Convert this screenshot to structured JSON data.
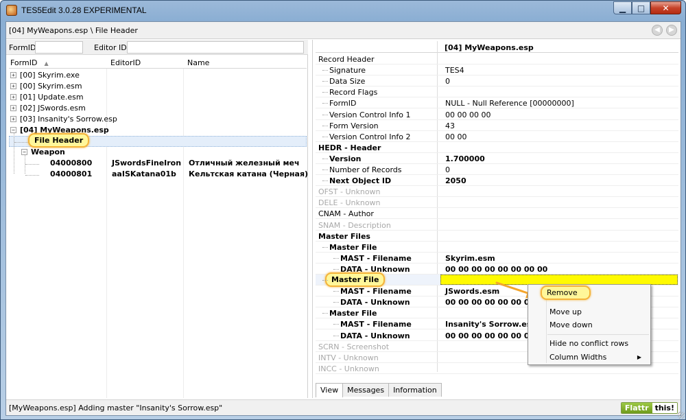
{
  "window": {
    "title": "TES5Edit 3.0.28 EXPERIMENTAL",
    "min": "▁",
    "max": "□",
    "close": "✕"
  },
  "pathbar": {
    "path": "[04] MyWeapons.esp \\ File Header",
    "back": "◀",
    "forward": "▶"
  },
  "filter": {
    "formid_label": "FormID",
    "editorid_label": "Editor ID"
  },
  "tree": {
    "columns": {
      "formid": "FormID",
      "editorid": "EditorID",
      "name": "Name",
      "sort_glyph": "▲"
    },
    "plugins": [
      {
        "label": "[00] Skyrim.exe",
        "expander": "+"
      },
      {
        "label": "[00] Skyrim.esm",
        "expander": "+"
      },
      {
        "label": "[01] Update.esm",
        "expander": "+"
      },
      {
        "label": "[02] JSwords.esm",
        "expander": "+"
      },
      {
        "label": "[03] Insanity's Sorrow.esp",
        "expander": "+"
      },
      {
        "label": "[04] MyWeapons.esp",
        "expander": "−"
      }
    ],
    "file_header": "File Header",
    "group": {
      "label": "Weapon",
      "expander": "−"
    },
    "records": [
      {
        "formid": "04000800",
        "editorid": "JSwordsFineIron",
        "name": "Отличный железный меч"
      },
      {
        "formid": "04000801",
        "editorid": "aaISKatana01b",
        "name": "Кельтская катана (Черная)"
      }
    ]
  },
  "view": {
    "header": "[04] MyWeapons.esp",
    "rows": [
      {
        "key": "Record Header",
        "value": "",
        "indent": 0,
        "style": "normal"
      },
      {
        "key": "Signature",
        "value": "TES4",
        "indent": 1,
        "style": "normal"
      },
      {
        "key": "Data Size",
        "value": "0",
        "indent": 1,
        "style": "normal"
      },
      {
        "key": "Record Flags",
        "value": "",
        "indent": 1,
        "style": "normal"
      },
      {
        "key": "FormID",
        "value": "NULL - Null Reference [00000000]",
        "indent": 1,
        "style": "normal"
      },
      {
        "key": "Version Control Info 1",
        "value": "00 00 00 00",
        "indent": 1,
        "style": "normal"
      },
      {
        "key": "Form Version",
        "value": "43",
        "indent": 1,
        "style": "normal"
      },
      {
        "key": "Version Control Info 2",
        "value": "00 00",
        "indent": 1,
        "style": "normal"
      },
      {
        "key": "HEDR - Header",
        "value": "",
        "indent": 0,
        "style": "bold"
      },
      {
        "key": "Version",
        "value": "1.700000",
        "indent": 1,
        "style": "bold"
      },
      {
        "key": "Number of Records",
        "value": "0",
        "indent": 1,
        "style": "normal"
      },
      {
        "key": "Next Object ID",
        "value": "2050",
        "indent": 1,
        "style": "bold"
      },
      {
        "key": "OFST - Unknown",
        "value": "",
        "indent": 0,
        "style": "gray"
      },
      {
        "key": "DELE - Unknown",
        "value": "",
        "indent": 0,
        "style": "gray"
      },
      {
        "key": "CNAM - Author",
        "value": "",
        "indent": 0,
        "style": "normal"
      },
      {
        "key": "SNAM - Description",
        "value": "",
        "indent": 0,
        "style": "gray"
      },
      {
        "key": "Master Files",
        "value": "",
        "indent": 0,
        "style": "bold"
      },
      {
        "key": "Master File",
        "value": "",
        "indent": 1,
        "style": "bold"
      },
      {
        "key": "MAST - Filename",
        "value": "Skyrim.esm",
        "indent": 2,
        "style": "bold"
      },
      {
        "key": "DATA - Unknown",
        "value": "00 00 00 00 00 00 00 00",
        "indent": 2,
        "style": "bold"
      },
      {
        "key": "Master File",
        "value": "",
        "indent": 1,
        "style": "selected"
      },
      {
        "key": "MAST - Filename",
        "value": "JSwords.esm",
        "indent": 2,
        "style": "bold"
      },
      {
        "key": "DATA - Unknown",
        "value": "00 00 00 00 00 00 00 00",
        "indent": 2,
        "style": "bold"
      },
      {
        "key": "Master File",
        "value": "",
        "indent": 1,
        "style": "bold"
      },
      {
        "key": "MAST - Filename",
        "value": "Insanity's Sorrow.esp",
        "indent": 2,
        "style": "bold"
      },
      {
        "key": "DATA - Unknown",
        "value": "00 00 00 00 00 00 00 00",
        "indent": 2,
        "style": "bold"
      },
      {
        "key": "SCRN - Screenshot",
        "value": "",
        "indent": 0,
        "style": "gray"
      },
      {
        "key": "INTV - Unknown",
        "value": "",
        "indent": 0,
        "style": "gray"
      },
      {
        "key": "INCC - Unknown",
        "value": "",
        "indent": 0,
        "style": "gray"
      }
    ],
    "tabs": [
      "View",
      "Messages",
      "Information"
    ]
  },
  "context_menu": {
    "items": [
      "Remove",
      "Move up",
      "Move down",
      "Hide no conflict rows",
      "Column Widths"
    ],
    "submenu_glyph": "▶"
  },
  "status": {
    "text": "[MyWeapons.esp] Adding master \"Insanity's Sorrow.esp\"",
    "flattr": "Flattr",
    "flattr_this": "this!"
  },
  "colors": {
    "highlight_border": "#f4b43a",
    "highlight_fill": "#fff79a",
    "selected_cell": "#fffa00",
    "arrow": "#f4a52c"
  }
}
